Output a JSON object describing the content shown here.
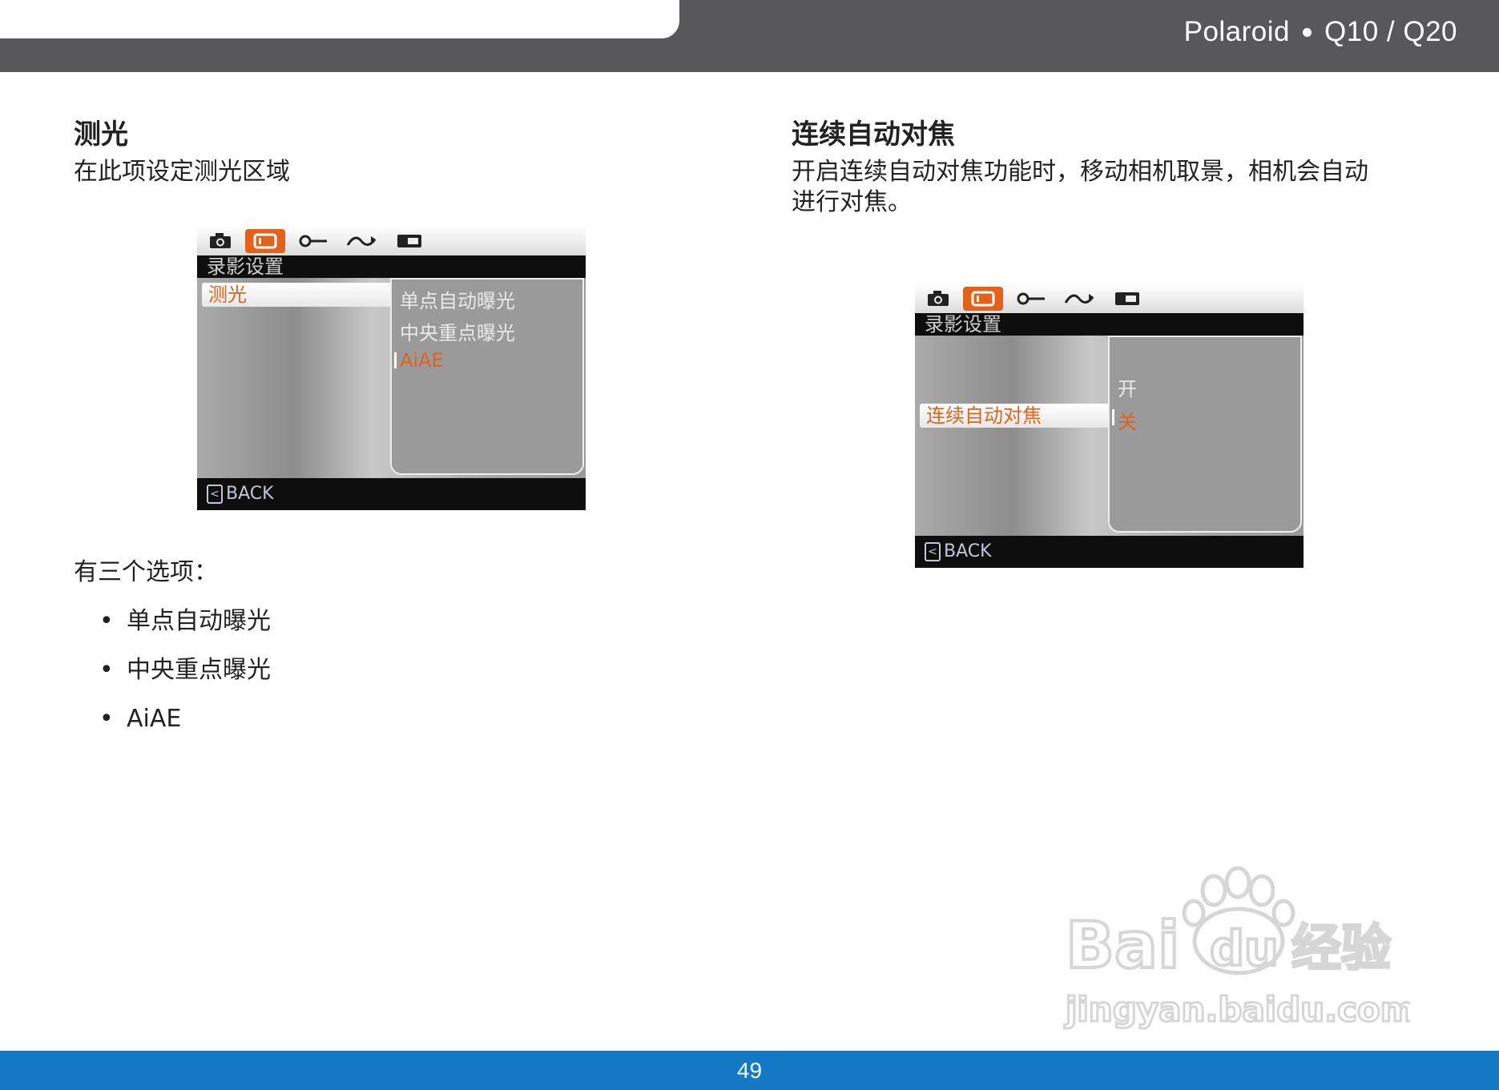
{
  "header": {
    "brand": "Polaroid",
    "model": "Q10 / Q20"
  },
  "left": {
    "heading": "测光",
    "description": "在此项设定测光区域",
    "options_intro": "有三个选项：",
    "options": [
      "单点自动曝光",
      "中央重点曝光",
      "AiAE"
    ],
    "screen": {
      "title": "录影设置",
      "menu_item": "测光",
      "submenu": [
        "单点自动曝光",
        "中央重点曝光",
        "AiAE"
      ],
      "selected_index": 2,
      "back_label": "BACK"
    }
  },
  "right": {
    "heading": "连续自动对焦",
    "description_line1": "开启连续自动对焦功能时，移动相机取景，相机会自动",
    "description_line2": "进行对焦。",
    "screen": {
      "title": "录影设置",
      "menu_item": "连续自动对焦",
      "submenu": [
        "开",
        "关"
      ],
      "selected_index": 1,
      "back_label": "BACK"
    }
  },
  "screen_tabs": [
    "camera-icon",
    "video-icon",
    "wrench-icon",
    "playback-icon",
    "card-icon"
  ],
  "watermark": {
    "brand": "Baidu经验",
    "url": "jingyan.baidu.com"
  },
  "footer": {
    "page_number": "49"
  },
  "colors": {
    "accent": "#e2621b",
    "header_bg": "#58585a",
    "footer_bg": "#1479c4"
  }
}
